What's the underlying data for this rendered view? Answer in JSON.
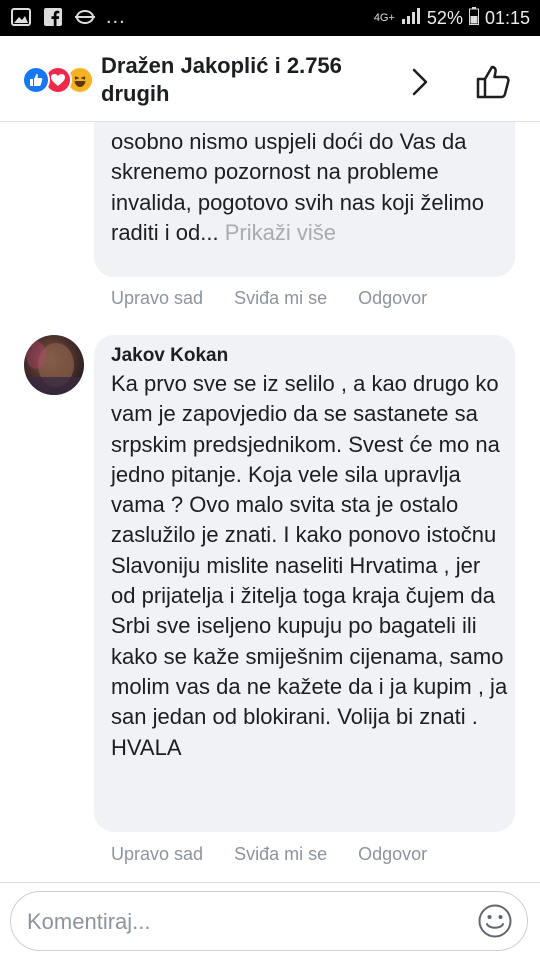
{
  "status_bar": {
    "left_icons": [
      "image-icon",
      "facebook-icon",
      "sync-icon"
    ],
    "overflow": "...",
    "network": "4G+",
    "battery": "52%",
    "time": "01:15"
  },
  "header": {
    "reactions": [
      "like",
      "love",
      "haha"
    ],
    "title": "Dražen Jakoplić i 2.756 drugih"
  },
  "comments": [
    {
      "author": "",
      "text": "osobno nismo uspjeli doći do Vas da skrenemo pozornost na probleme invalida, pogotovo svih nas koji želimo raditi i od...",
      "more": "Prikaži više",
      "actions": [
        "Upravo sad",
        "Sviđa mi se",
        "Odgovor"
      ]
    },
    {
      "author": "Jakov Kokan",
      "text": "Ka prvo sve se iz selilo , a kao drugo ko vam je zapovjedio da se sastanete sa srpskim predsjednikom. Svest će mo na jedno pitanje. Koja vele sila upravlja vama ? Ovo malo svita sta je ostalo zaslužilo je znati. I kako ponovo istočnu Slavoniju mislite naseliti Hrvatima , jer od prijatelja i žitelja toga kraja čujem da Srbi sve iseljeno kupuju po bagateli ili kako se kaže smiješnim cijenama, samo molim vas da ne kažete da i ja kupim , ja san jedan od blokirani. Volija bi znati . HVALA",
      "actions": [
        "Upravo sad",
        "Sviđa mi se",
        "Odgovor"
      ]
    }
  ],
  "composer": {
    "placeholder": "Komentiraj..."
  },
  "colors": {
    "accent": "#1877f2",
    "bubble": "#f0f2f5",
    "meta_text": "#8d949e"
  }
}
